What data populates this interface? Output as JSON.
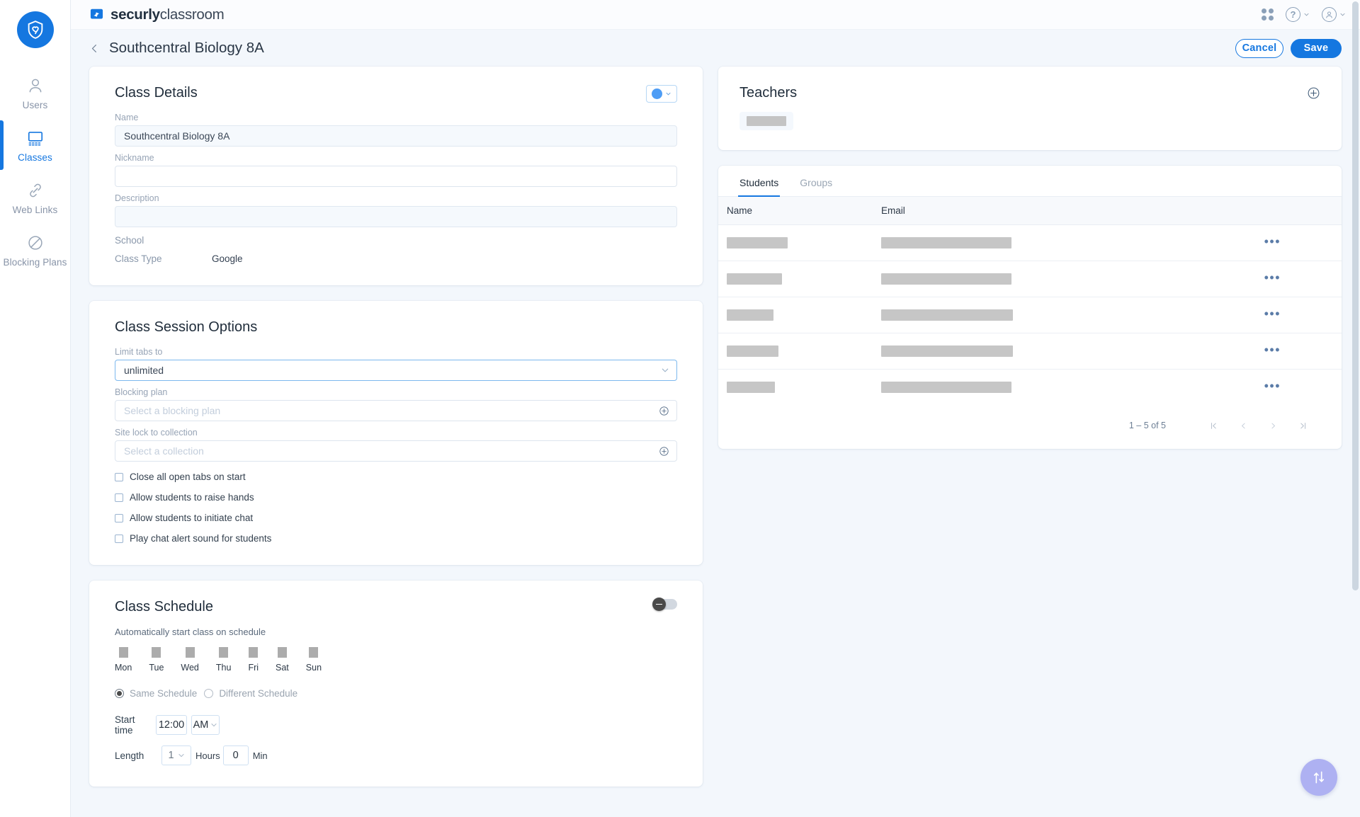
{
  "brand": {
    "bold": "securly",
    "light": "classroom",
    "logo_icon": "shield-heart-icon"
  },
  "topbar": {
    "apps_icon": "grid-apps-icon",
    "help_label": "?",
    "help_icon": "help-circle-icon",
    "account_icon": "user-circle-icon",
    "chevron_icon": "chevron-down-icon"
  },
  "header": {
    "back_icon": "chevron-left-icon",
    "title": "Southcentral Biology 8A",
    "cancel_label": "Cancel",
    "save_label": "Save",
    "accent_color": "#1577e0"
  },
  "class_details": {
    "title": "Class Details",
    "color_swatch": "#4e9df5",
    "color_chevron_icon": "chevron-down-icon",
    "name_label": "Name",
    "name_value": "Southcentral Biology 8A",
    "nickname_label": "Nickname",
    "nickname_value": "",
    "description_label": "Description",
    "description_value": "",
    "school_label": "School",
    "school_value": "",
    "class_type_label": "Class Type",
    "class_type_value": "Google"
  },
  "session_options": {
    "title": "Class Session Options",
    "limit_tabs_label": "Limit tabs to",
    "limit_tabs_value": "unlimited",
    "limit_tabs_chevron": "chevron-down-icon",
    "blocking_plan_label": "Blocking plan",
    "blocking_plan_placeholder": "Select a blocking plan",
    "blocking_plan_add_icon": "plus-circle-icon",
    "site_lock_label": "Site lock to collection",
    "site_lock_placeholder": "Select a collection",
    "site_lock_add_icon": "plus-circle-icon",
    "checkboxes": [
      {
        "label": "Close all open tabs on start",
        "checked": false
      },
      {
        "label": "Allow students to raise hands",
        "checked": false
      },
      {
        "label": "Allow students to initiate chat",
        "checked": false
      },
      {
        "label": "Play chat alert sound for students",
        "checked": false
      }
    ]
  },
  "schedule": {
    "title": "Class Schedule",
    "toggle_on": false,
    "auto_start_label": "Automatically start class on schedule",
    "days": [
      "Mon",
      "Tue",
      "Wed",
      "Thu",
      "Fri",
      "Sat",
      "Sun"
    ],
    "same_schedule_label": "Same Schedule",
    "different_schedule_label": "Different Schedule",
    "schedule_mode": "Same Schedule",
    "start_time_label": "Start time",
    "start_time_value": "12:00",
    "meridiem_value": "AM",
    "meridiem_chevron": "chevron-down-icon",
    "length_label": "Length",
    "hours_value": "1",
    "hours_chevron": "chevron-down-icon",
    "hours_unit": "Hours",
    "minutes_value": "0",
    "minutes_unit": "Min"
  },
  "teachers": {
    "title": "Teachers",
    "add_icon": "plus-circle-icon",
    "items": [
      {
        "placeholder_width": 60
      }
    ]
  },
  "roster": {
    "tabs": [
      {
        "label": "Students",
        "active": true
      },
      {
        "label": "Groups",
        "active": false
      }
    ],
    "columns": [
      "Name",
      "Email"
    ],
    "rows": [
      {
        "name_width": 86,
        "email_width": 184,
        "menu_icon": "more-horizontal-icon"
      },
      {
        "name_width": 78,
        "email_width": 184,
        "menu_icon": "more-horizontal-icon"
      },
      {
        "name_width": 66,
        "email_width": 186,
        "menu_icon": "more-horizontal-icon"
      },
      {
        "name_width": 73,
        "email_width": 186,
        "menu_icon": "more-horizontal-icon"
      },
      {
        "name_width": 68,
        "email_width": 184,
        "menu_icon": "more-horizontal-icon"
      }
    ],
    "pagination": {
      "range_label": "1 – 5 of 5",
      "first_icon": "first-page-icon",
      "prev_icon": "chevron-left-icon",
      "next_icon": "chevron-right-icon",
      "last_icon": "last-page-icon"
    }
  },
  "sidebar": {
    "items": [
      {
        "label": "Users",
        "icon": "user-icon",
        "active": false
      },
      {
        "label": "Classes",
        "icon": "monitor-icon",
        "active": true
      },
      {
        "label": "Web Links",
        "icon": "link-icon",
        "active": false
      },
      {
        "label": "Blocking Plans",
        "icon": "block-circle-icon",
        "active": false
      }
    ]
  },
  "fab": {
    "icon": "sort-updown-icon",
    "color": "#aeb1f2"
  }
}
